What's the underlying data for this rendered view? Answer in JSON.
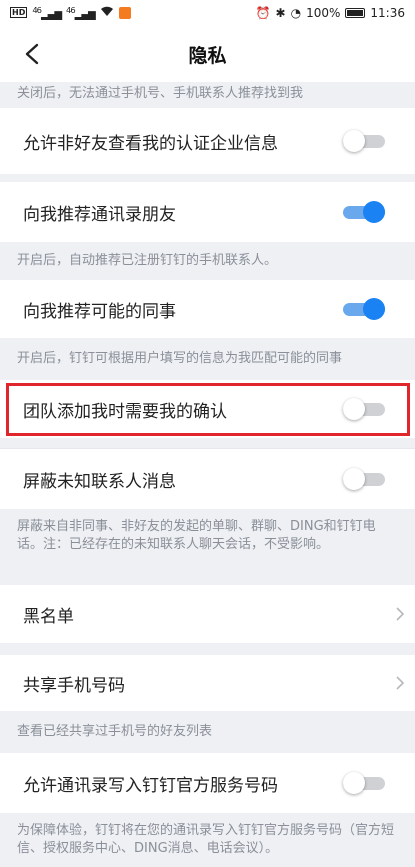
{
  "status_bar": {
    "left_badge": "HD",
    "signal_1": "46",
    "signal_2": "46",
    "battery_percent": "100%",
    "time": "11:36"
  },
  "header": {
    "title": "隐私"
  },
  "notes": {
    "top": "关闭后，无法通过手机号、手机联系人推荐找到我",
    "contacts": "开启后，自动推荐已注册钉钉的手机联系人。",
    "colleagues": "开启后，钉钉可根据用户填写的信息为我匹配可能的同事",
    "unknown": "屏蔽来自非同事、非好友的发起的单聊、群聊、DING和钉钉电话。注：已经存在的未知联系人聊天会话，不受影响。",
    "share_phone": "查看已经共享过手机号的好友列表",
    "bottom": "为保障体验，钉钉将在您的通讯录写入钉钉官方服务号码（官方短信、授权服务中心、DING消息、电话会议）。"
  },
  "settings": {
    "enterprise_info": {
      "label": "允许非好友查看我的认证企业信息",
      "enabled": false
    },
    "recommend_contacts": {
      "label": "向我推荐通讯录朋友",
      "enabled": true
    },
    "recommend_colleagues": {
      "label": "向我推荐可能的同事",
      "enabled": true
    },
    "team_confirm": {
      "label": "团队添加我时需要我的确认",
      "enabled": false
    },
    "block_unknown": {
      "label": "屏蔽未知联系人消息",
      "enabled": false
    },
    "blacklist": {
      "label": "黑名单"
    },
    "share_phone": {
      "label": "共享手机号码"
    },
    "write_official": {
      "label": "允许通讯录写入钉钉官方服务号码",
      "enabled": false
    }
  },
  "colors": {
    "accent": "#1a82f2",
    "highlight": "#e0262c"
  }
}
